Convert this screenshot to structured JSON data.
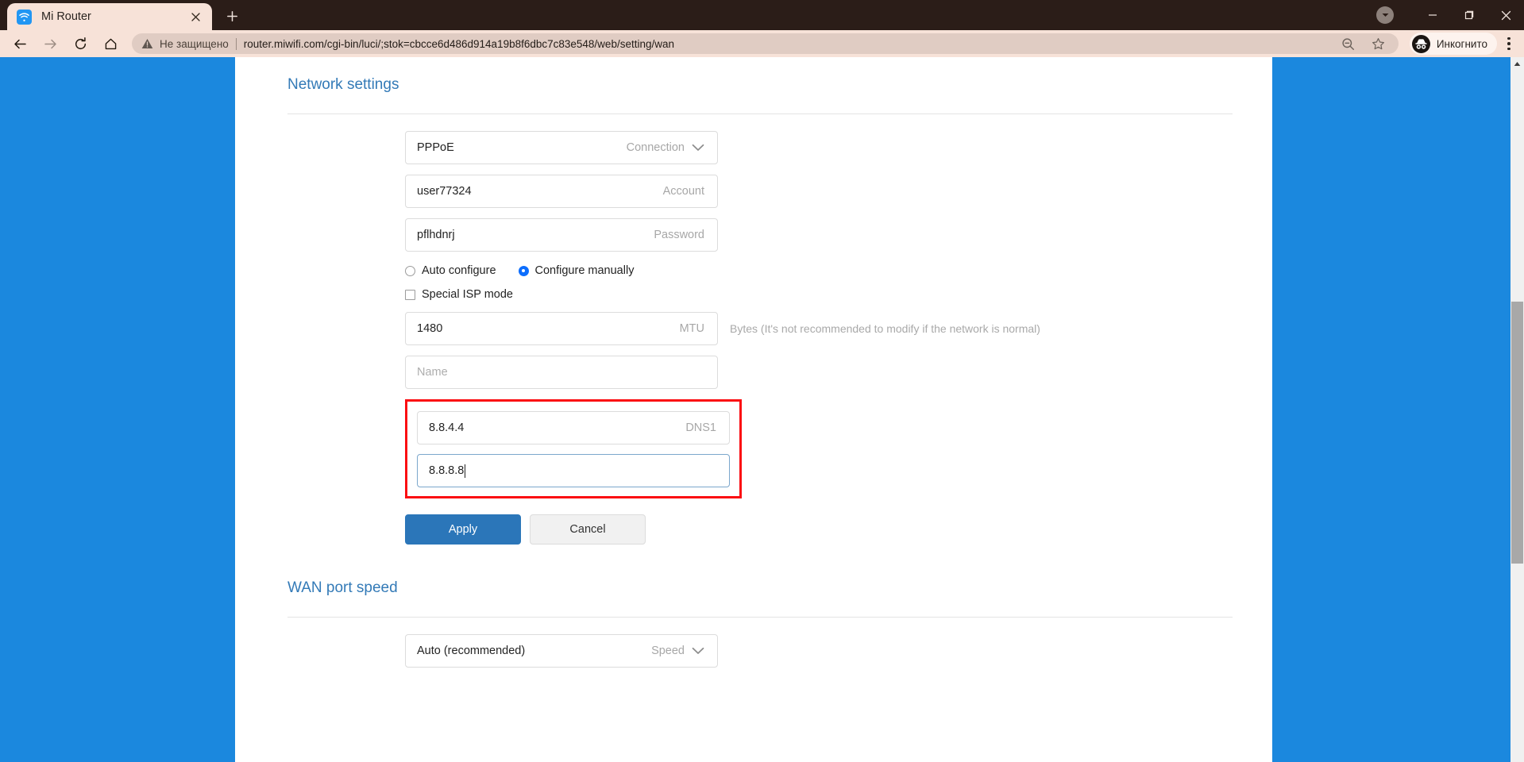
{
  "browser": {
    "tab": {
      "title": "Mi Router",
      "favicon_name": "wifi-icon",
      "close_label": "×"
    },
    "new_tab_label": "+",
    "window_controls": {
      "restore_down_label": "⌄",
      "minimize_label": "—",
      "maximize_label": "❐",
      "close_label": "×"
    },
    "toolbar": {
      "back_label": "←",
      "forward_label": "→",
      "reload_label": "↻",
      "home_label": "⌂",
      "security_text": "Не защищено",
      "url": "router.miwifi.com/cgi-bin/luci/;stok=cbcce6d486d914a19b8f6dbc7c83e548/web/setting/wan",
      "zoom_icon_name": "zoom-out-icon",
      "bookmark_icon_name": "star-icon",
      "profile_label": "Инкогнито",
      "menu_icon_name": "kebab-menu-icon"
    }
  },
  "page": {
    "network_settings": {
      "title": "Network settings",
      "fields": [
        {
          "value": "PPPoE",
          "label": "Connection",
          "placeholder": "",
          "has_chevron": true,
          "focused": false
        },
        {
          "value": "user77324",
          "label": "Account",
          "placeholder": "",
          "has_chevron": false,
          "focused": false
        },
        {
          "value": "pflhdnrj",
          "label": "Password",
          "placeholder": "",
          "has_chevron": false,
          "focused": false
        }
      ],
      "config_mode": {
        "auto_label": "Auto configure",
        "manual_label": "Configure manually",
        "selected": "manual"
      },
      "special_isp": {
        "label": "Special ISP mode",
        "checked": false
      },
      "mtu": {
        "value": "1480",
        "label": "MTU",
        "hint": "Bytes (It's not recommended to modify if the network is normal)"
      },
      "name_field": {
        "value": "",
        "placeholder": "Name",
        "label": ""
      },
      "dns": {
        "highlight_color": "#fb0d12",
        "dns1": {
          "value": "8.8.4.4",
          "label": "DNS1",
          "focused": false
        },
        "dns2": {
          "value": "8.8.8.8",
          "label": "",
          "focused": true
        }
      },
      "buttons": {
        "apply": "Apply",
        "cancel": "Cancel"
      }
    },
    "wan_port_speed": {
      "title": "WAN port speed",
      "speed_field": {
        "value": "Auto (recommended)",
        "label": "Speed"
      }
    }
  },
  "colors": {
    "accent_blue": "#1b88de",
    "heading_blue": "#337ab7",
    "primary_button": "#2b76b9",
    "annotation_red": "#fb0d12"
  }
}
